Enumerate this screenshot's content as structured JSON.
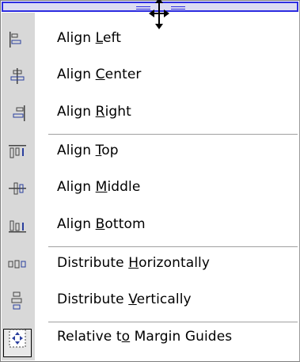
{
  "menu": {
    "items": [
      {
        "pre": "Align ",
        "key": "L",
        "post": "eft",
        "icon": "align-left-icon"
      },
      {
        "pre": "Align ",
        "key": "C",
        "post": "enter",
        "icon": "align-center-icon"
      },
      {
        "pre": "Align ",
        "key": "R",
        "post": "ight",
        "icon": "align-right-icon"
      },
      {
        "pre": "Align ",
        "key": "T",
        "post": "op",
        "icon": "align-top-icon"
      },
      {
        "pre": "Align ",
        "key": "M",
        "post": "iddle",
        "icon": "align-middle-icon"
      },
      {
        "pre": "Align ",
        "key": "B",
        "post": "ottom",
        "icon": "align-bottom-icon"
      },
      {
        "pre": "Distribute ",
        "key": "H",
        "post": "orizontally",
        "icon": "distribute-horizontally-icon"
      },
      {
        "pre": "Distribute ",
        "key": "V",
        "post": "ertically",
        "icon": "distribute-vertically-icon"
      },
      {
        "pre": "Relative t",
        "key": "o",
        "post": " Margin Guides",
        "icon": "relative-to-margin-guides-icon",
        "checked": true
      }
    ]
  },
  "colors": {
    "title_bar": "#2d2de0",
    "gutter": "#d8d8d8",
    "icon_blue": "#2a3f9e"
  }
}
